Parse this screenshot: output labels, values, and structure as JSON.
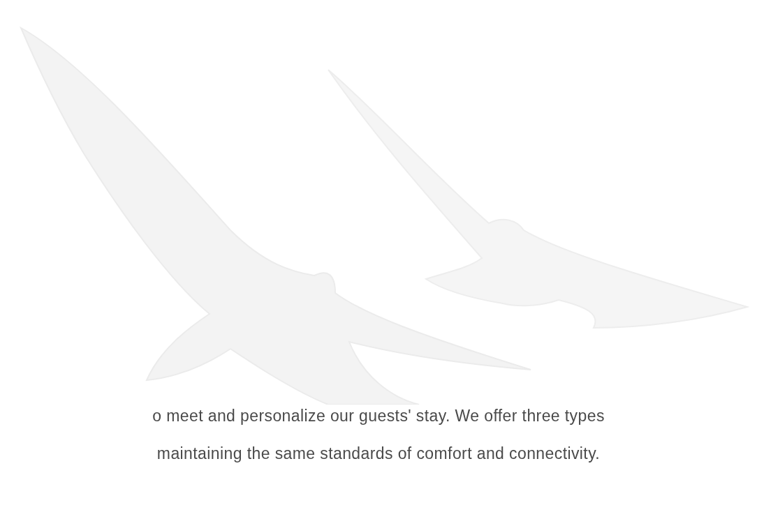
{
  "text_lines": [
    "o meet and personalize our guests' stay. We offer three types",
    "maintaining the same standards of comfort and connectivity."
  ]
}
